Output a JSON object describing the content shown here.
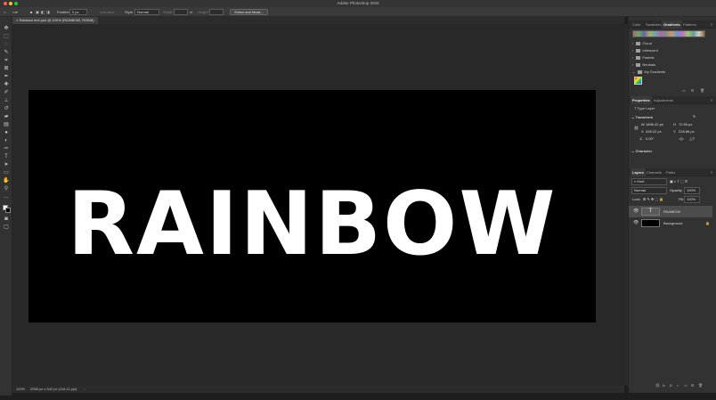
{
  "app": {
    "title": "Adobe Photoshop 2020"
  },
  "options": {
    "feather_label": "Feather:",
    "feather_value": "0 px",
    "antialias_label": "Anti-alias",
    "style_label": "Style:",
    "style_value": "Normal",
    "width_label": "Width:",
    "height_label": "Height:",
    "select_mask_label": "Select and Mask..."
  },
  "document": {
    "tab_label": "Rainbow text.psd @ 100% (RAINBOW, RGB/8)",
    "text": "RAINBOW",
    "status": "2558 px x 642 px (118.11 ppi)",
    "zoom": "100%"
  },
  "gradients": {
    "tabs": [
      "Color",
      "Swatches",
      "Gradients",
      "Patterns"
    ],
    "active_tab": "Gradients",
    "folders": [
      "Cloud",
      "Iridescent",
      "Pastels",
      "Neutrals",
      "My Gradients"
    ]
  },
  "properties": {
    "tabs": [
      "Properties",
      "Adjustments"
    ],
    "kind": "Type Layer",
    "transform_label": "Transform",
    "w": "1896.42 px",
    "h": "72.55 px",
    "x": "428.22 px",
    "y": "228.86 px",
    "angle": "0.00°",
    "character_label": "Character"
  },
  "layers": {
    "tabs": [
      "Layers",
      "Channels",
      "Paths"
    ],
    "kind_label": "Kind",
    "blend_mode": "Normal",
    "opacity_label": "Opacity:",
    "opacity_value": "100%",
    "lock_label": "Lock:",
    "fill_label": "Fill:",
    "fill_value": "100%",
    "items": [
      {
        "name": "RAINBOW",
        "thumb_icon": "T"
      },
      {
        "name": "Background"
      }
    ]
  },
  "colors": {
    "window_bg": "#282828",
    "panel_bg": "#323232",
    "accent_red": "#ff5f57",
    "accent_yellow": "#febc2e",
    "accent_green": "#28c840"
  },
  "tool_icons": [
    "move-icon",
    "marquee-icon",
    "lasso-icon",
    "quick-select-icon",
    "crop-icon",
    "frame-icon",
    "eyedropper-icon",
    "healing-icon",
    "brush-icon",
    "stamp-icon",
    "history-brush-icon",
    "eraser-icon",
    "gradient-icon",
    "blur-icon",
    "dodge-icon",
    "pen-icon",
    "type-icon",
    "path-select-icon",
    "rectangle-icon",
    "hand-icon",
    "zoom-icon",
    "more-icon"
  ]
}
